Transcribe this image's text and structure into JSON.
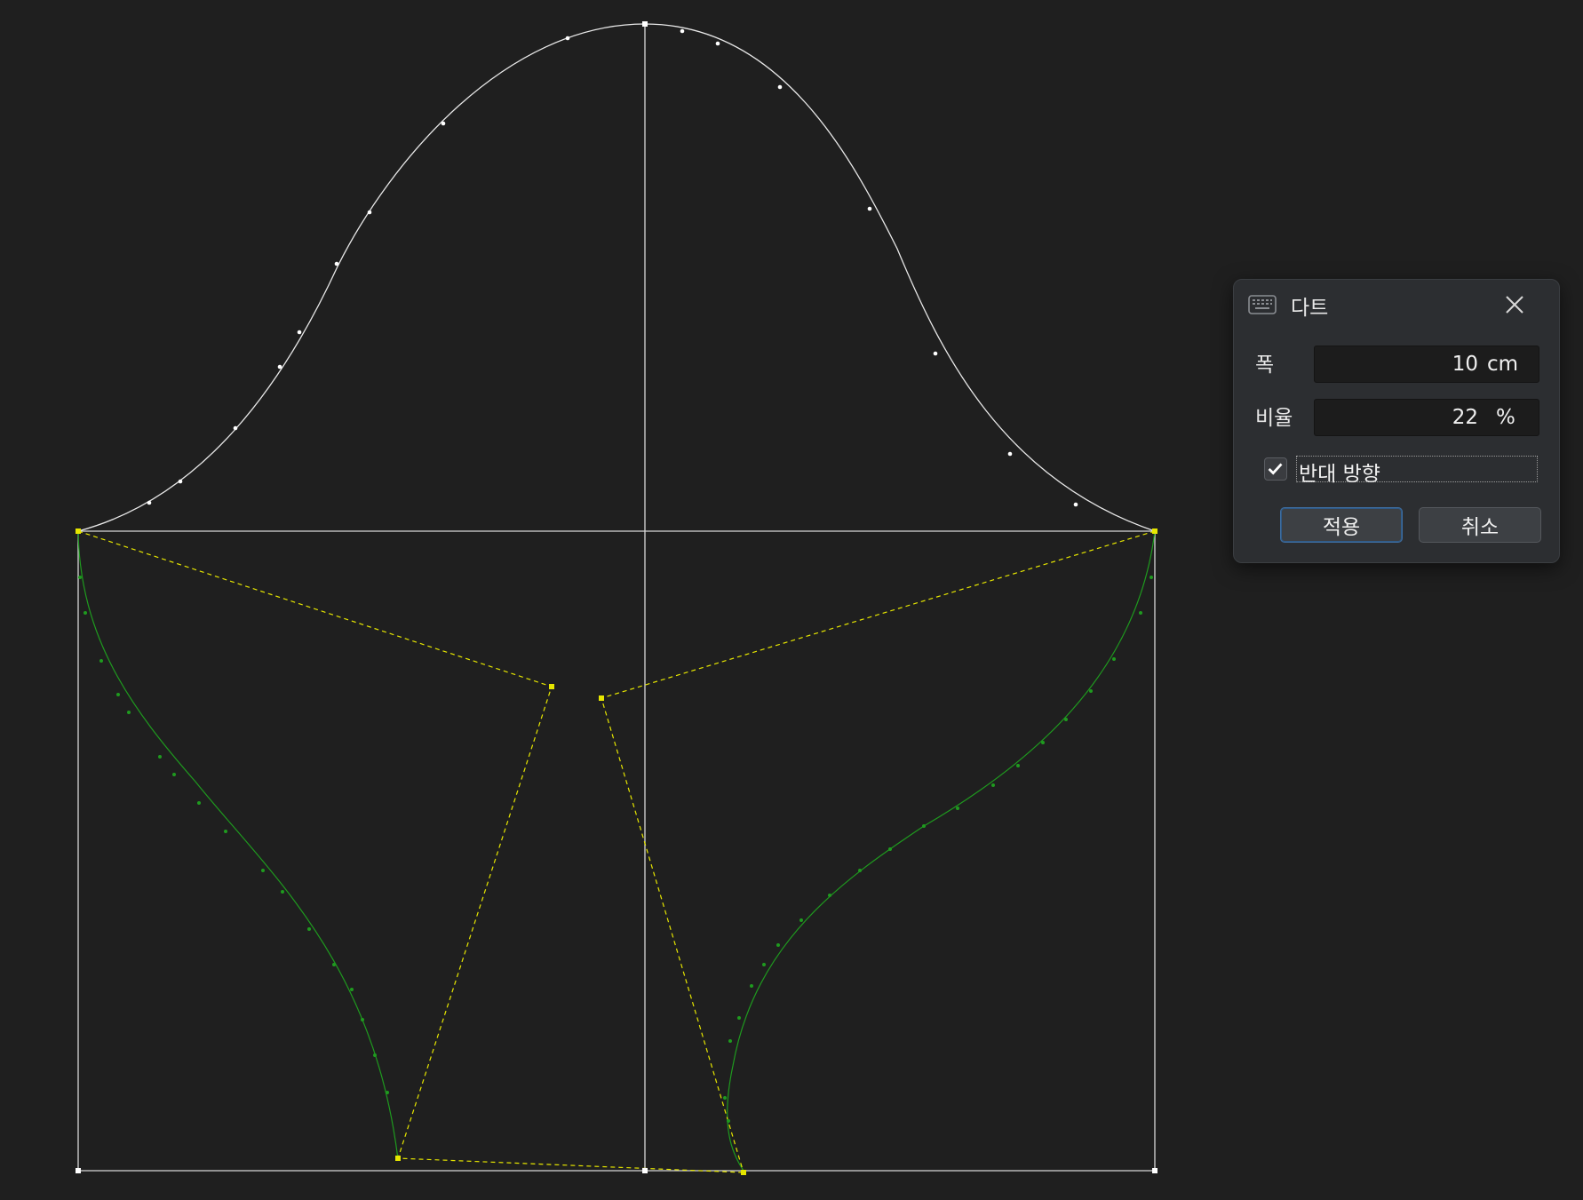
{
  "dialog": {
    "title": "다트",
    "icon": "keyboard-icon",
    "close_icon": "close-icon",
    "width_label": "폭",
    "width_value": "10",
    "width_unit": "cm",
    "ratio_label": "비율",
    "ratio_value": "22",
    "ratio_unit": "%",
    "reverse_checked": true,
    "reverse_label": "반대 방향",
    "apply_label": "적용",
    "cancel_label": "취소"
  },
  "colors": {
    "background": "#1f1f1f",
    "outline": "#e8e8e8",
    "dart_guide": "#e6e600",
    "curve": "#1f9a1f",
    "dialog_bg": "#2c2e31"
  }
}
